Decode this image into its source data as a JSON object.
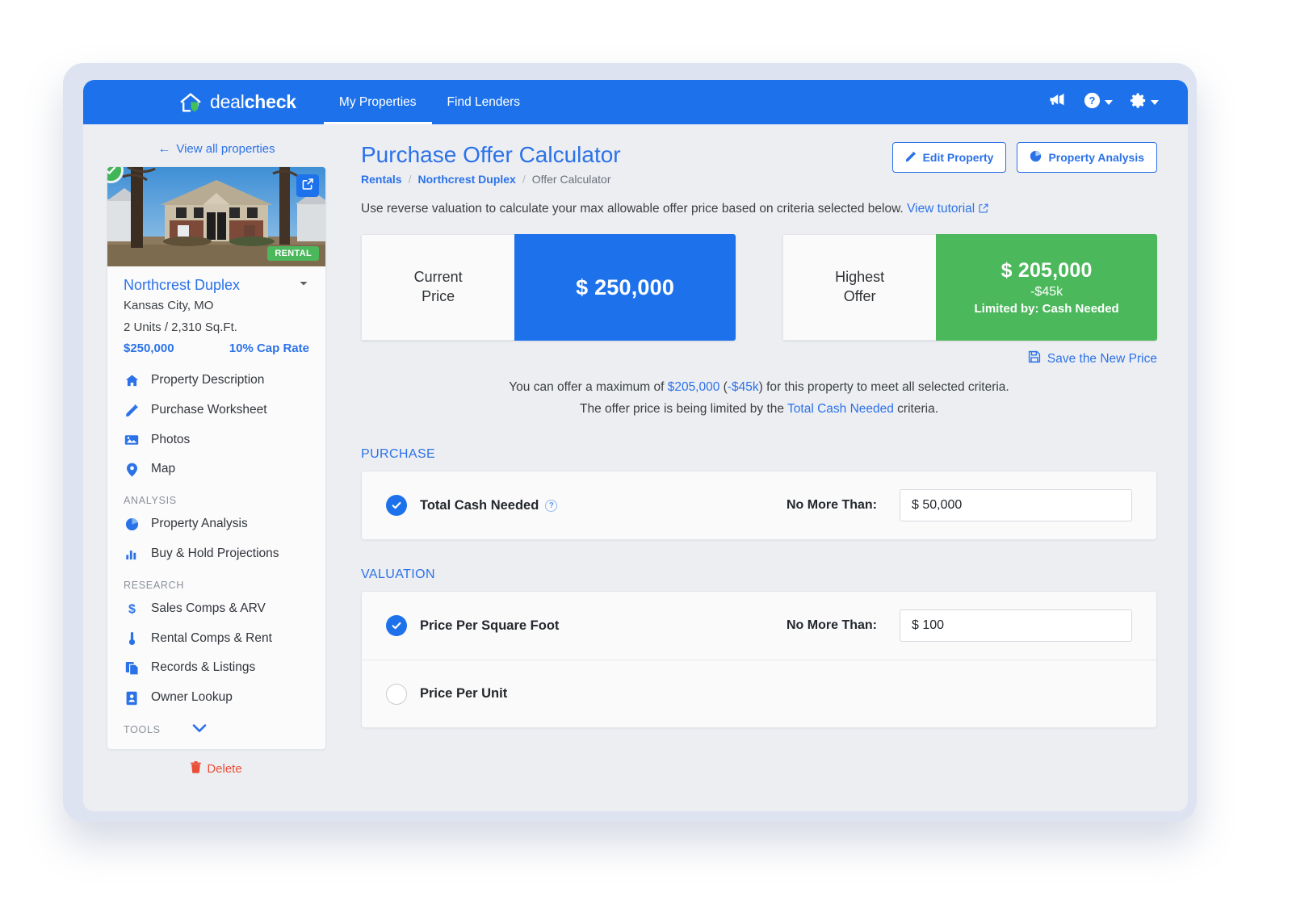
{
  "topnav": {
    "brand_light": "deal",
    "brand_bold": "check",
    "logo_icon": "house-shield-logo",
    "links": [
      {
        "label": "My Properties",
        "active": true
      },
      {
        "label": "Find Lenders",
        "active": false
      }
    ],
    "icons": [
      {
        "name": "megaphone-icon",
        "caret": false
      },
      {
        "name": "help-circle-icon",
        "caret": true
      },
      {
        "name": "gear-icon",
        "caret": true
      }
    ],
    "accent": "#1d72ec"
  },
  "sidebar": {
    "back_label": "View all properties",
    "photo": {
      "status_badge": "verified-check",
      "share_icon": "share-icon",
      "tag": "RENTAL"
    },
    "property": {
      "name": "Northcrest Duplex",
      "location": "Kansas City, MO",
      "details": "2 Units  /  2,310 Sq.Ft.",
      "price": "$250,000",
      "cap_rate": "10% Cap Rate"
    },
    "items": [
      {
        "label": "Property Description",
        "icon": "home-icon"
      },
      {
        "label": "Purchase Worksheet",
        "icon": "pencil-icon"
      },
      {
        "label": "Photos",
        "icon": "photo-icon"
      },
      {
        "label": "Map",
        "icon": "map-pin-icon"
      }
    ],
    "analysis_heading": "ANALYSIS",
    "analysis_items": [
      {
        "label": "Property Analysis",
        "icon": "pie-chart-icon"
      },
      {
        "label": "Buy & Hold Projections",
        "icon": "bar-chart-icon"
      }
    ],
    "research_heading": "RESEARCH",
    "research_items": [
      {
        "label": "Sales Comps & ARV",
        "icon": "dollar-icon"
      },
      {
        "label": "Rental Comps & Rent",
        "icon": "thermometer-icon"
      },
      {
        "label": "Records & Listings",
        "icon": "documents-icon"
      },
      {
        "label": "Owner Lookup",
        "icon": "address-book-icon"
      }
    ],
    "tools_heading": "TOOLS",
    "tools_chevron": "chevron-down-icon",
    "delete_label": "Delete",
    "delete_icon": "trash-icon",
    "delete_color": "#e8503a"
  },
  "main": {
    "title": "Purchase Offer Calculator",
    "breadcrumb": {
      "first": "Rentals",
      "second": "Northcrest Duplex",
      "current": "Offer Calculator",
      "separator": "/"
    },
    "buttons": [
      {
        "label": "Edit Property",
        "icon": "pencil-icon"
      },
      {
        "label": "Property Analysis",
        "icon": "pie-chart-icon"
      }
    ],
    "lede_text": "Use reverse valuation to calculate your max allowable offer price based on criteria selected below.",
    "lede_link": "View tutorial",
    "lede_link_icon": "external-link-icon",
    "cards": [
      {
        "label_line1": "Current",
        "label_line2": "Price",
        "amount": "$ 250,000",
        "delta": "",
        "note": "",
        "color": "#1d72ec"
      },
      {
        "label_line1": "Highest",
        "label_line2": "Offer",
        "amount": "$ 205,000",
        "delta": "-$45k",
        "note": "Limited by: Cash Needed",
        "color": "#4cb85c"
      }
    ],
    "save_link": "Save the New Price",
    "save_icon": "floppy-disk-icon",
    "summary_line1_a": "You can offer a maximum of ",
    "summary_line1_amount": "$205,000",
    "summary_line1_b": " (",
    "summary_line1_delta": "-$45k",
    "summary_line1_c": ") for this property to meet all selected criteria.",
    "summary_line2_a": "The offer price is being limited by the ",
    "summary_line2_link": "Total Cash Needed",
    "summary_line2_b": " criteria.",
    "sections": [
      {
        "heading": "PURCHASE",
        "rows": [
          {
            "selected": true,
            "label": "Total Cash Needed",
            "has_help": true,
            "help_glyph": "?",
            "condition": "No More Than:",
            "value": "$ 50,000",
            "has_input": true
          }
        ]
      },
      {
        "heading": "VALUATION",
        "rows": [
          {
            "selected": true,
            "label": "Price Per Square Foot",
            "has_help": false,
            "condition": "No More Than:",
            "value": "$ 100",
            "has_input": true
          },
          {
            "selected": false,
            "label": "Price Per Unit",
            "has_help": false,
            "condition": "",
            "value": "",
            "has_input": false
          }
        ]
      }
    ]
  }
}
